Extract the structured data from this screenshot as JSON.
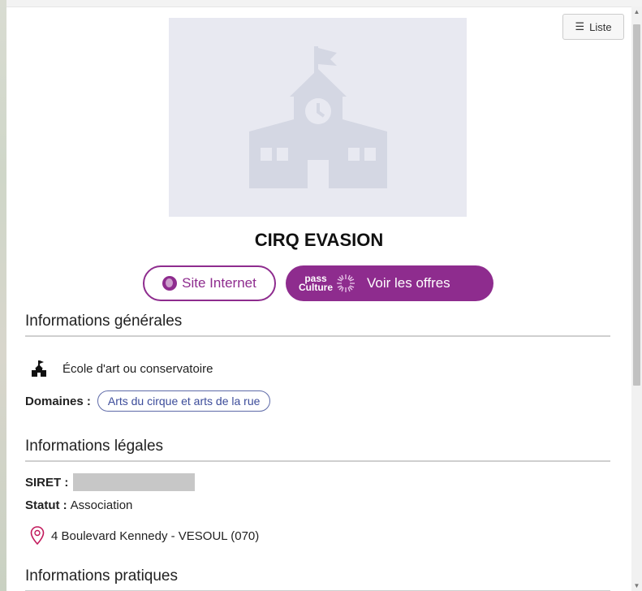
{
  "toolbar": {
    "list_label": "Liste"
  },
  "venue": {
    "name": "CIRQ EVASION"
  },
  "actions": {
    "site_label": "Site Internet",
    "offres_label": "Voir les offres",
    "pass_line1": "pass",
    "pass_line2": "Culture"
  },
  "sections": {
    "general": {
      "title": "Informations générales",
      "category": "École d'art ou conservatoire",
      "domains_label": "Domaines :",
      "domains": [
        "Arts du cirque et arts de la rue"
      ]
    },
    "legal": {
      "title": "Informations légales",
      "siret_label": "SIRET :",
      "statut_label": "Statut :",
      "statut_value": "Association",
      "address": "4 Boulevard Kennedy - VESOUL (070)"
    },
    "practical": {
      "title": "Informations pratiques"
    }
  },
  "colors": {
    "accent": "#8e2c8e",
    "chip": "#3c4c9a",
    "hero_bg": "#e8e9f1",
    "hero_icon": "#d4d7e3"
  }
}
